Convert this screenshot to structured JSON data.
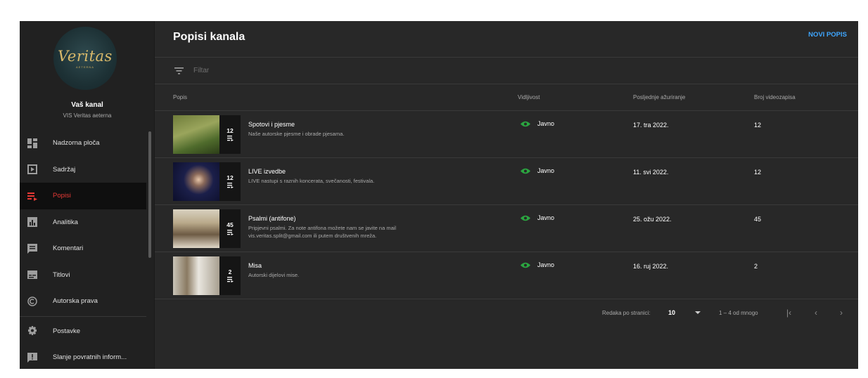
{
  "sidebar": {
    "logo_text": "Veritas",
    "logo_sub": "AETERNA",
    "channel_name": "Vaš kanal",
    "channel_sub": "VIS Veritas aeterna",
    "items": [
      {
        "label": "Nadzorna ploča",
        "icon": "dashboard-icon"
      },
      {
        "label": "Sadržaj",
        "icon": "content-icon"
      },
      {
        "label": "Popisi",
        "icon": "playlist-icon",
        "active": true
      },
      {
        "label": "Analitika",
        "icon": "analytics-icon"
      },
      {
        "label": "Komentari",
        "icon": "comments-icon"
      },
      {
        "label": "Titlovi",
        "icon": "subtitles-icon"
      },
      {
        "label": "Autorska prava",
        "icon": "copyright-icon"
      }
    ],
    "bottom_items": [
      {
        "label": "Postavke",
        "icon": "gear-icon"
      },
      {
        "label": "Slanje povratnih inform...",
        "icon": "feedback-icon"
      }
    ]
  },
  "header": {
    "title": "Popisi kanala",
    "new_button": "NOVI POPIS"
  },
  "filter": {
    "placeholder": "Filtar"
  },
  "table": {
    "columns": [
      "Popis",
      "Vidljivost",
      "Posljednje ažuriranje",
      "Broj videozapisa"
    ],
    "rows": [
      {
        "title": "Spotovi i pjesme",
        "desc": "Naše autorske pjesme i obrade pjesama.",
        "count": "12",
        "visibility": "Javno",
        "updated": "17. tra 2022.",
        "videos": "12"
      },
      {
        "title": "LIVE izvedbe",
        "desc": "LIVE nastupi s raznih koncerata, svečanosti, festivala.",
        "count": "12",
        "visibility": "Javno",
        "updated": "11. svi 2022.",
        "videos": "12"
      },
      {
        "title": "Psalmi (antifone)",
        "desc": "Pripjevni psalmi. Za note antifona možete nam se javite na mail vis.veritas.split@gmail.com ili putem društvenih mreža.",
        "count": "45",
        "visibility": "Javno",
        "updated": "25. ožu 2022.",
        "videos": "45"
      },
      {
        "title": "Misa",
        "desc": "Autorski dijelovi mise.",
        "count": "2",
        "visibility": "Javno",
        "updated": "16. ruj 2022.",
        "videos": "2"
      }
    ]
  },
  "footer": {
    "rows_label": "Redaka po stranici:",
    "rows_value": "10",
    "range": "1 – 4 od mnogo"
  },
  "colors": {
    "accent": "#3ea6ff",
    "active": "#e53935",
    "public": "#2ba640"
  }
}
